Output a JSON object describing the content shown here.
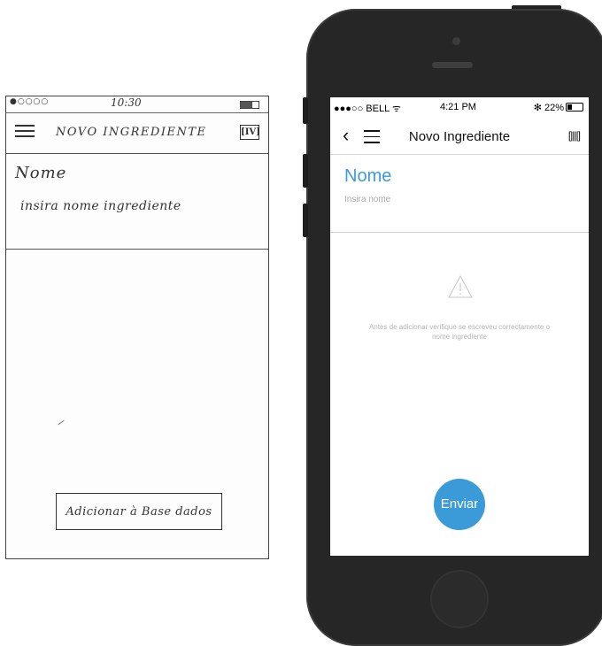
{
  "sketch": {
    "status_dots": "●○○○○",
    "time": "10:30",
    "title": "NOVO INGREDIENTE",
    "barcode_glyph": "[IV]",
    "name_label": "Nome",
    "name_placeholder": "insira nome ingrediente",
    "add_button": "Adicionar à Base dados"
  },
  "phone": {
    "status": {
      "carrier": "●●●○○ BELL ᯤ",
      "time": "4:21 PM",
      "battery": "✻ 22%"
    },
    "nav": {
      "back_icon": "back-chevron-icon",
      "menu_icon": "hamburger-menu-icon",
      "title": "Novo Ingrediente",
      "barcode_icon": "barcode-scanner-icon"
    },
    "form": {
      "name_label": "Nome",
      "name_placeholder": "Insira nome"
    },
    "notice": {
      "icon": "warning-triangle-icon",
      "text": "Antes de adicionar verifique se escreveu correctamente o nome ingrediente"
    },
    "submit_label": "Enviar",
    "accent_color": "#3a9bd8"
  }
}
